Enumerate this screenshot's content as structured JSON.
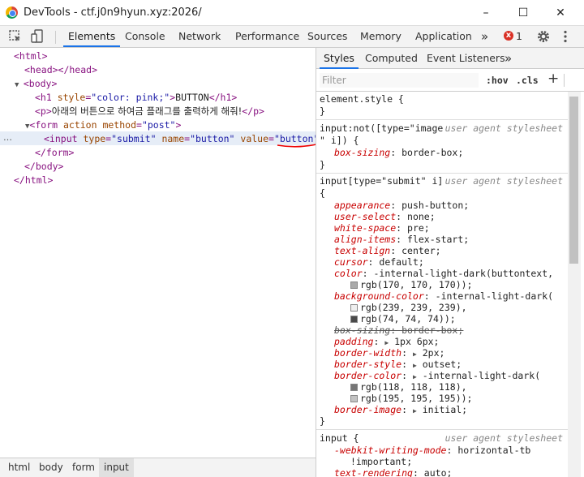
{
  "window": {
    "title": "DevTools - ctf.j0n9hyun.xyz:2026/",
    "min_label": "–",
    "max_label": "☐",
    "close_label": "✕"
  },
  "toolbar": {
    "tabs": [
      "Elements",
      "Console",
      "Network",
      "Performance",
      "Sources",
      "Memory",
      "Application"
    ],
    "more_label": "»",
    "error_count": "1",
    "error_icon": "x",
    "settings_icon": "gear-icon",
    "menu_icon": "kebab-icon"
  },
  "elements": {
    "html_open": "<html>",
    "head": "<head></head>",
    "body_open": "<body>",
    "h1_open": "<h1 ",
    "h1_attr": "style",
    "h1_val": "\"color: pink;\"",
    "h1_text": "BUTTON",
    "h1_close": "</h1>",
    "p_open": "<p>",
    "p_text": "아래의 버튼으로 하여금 플래그를 출력하게 해줘!",
    "p_close": "</p>",
    "form_open": "<form ",
    "form_attr1": "action",
    "form_attr2": "method",
    "form_val2": "\"post\"",
    "input_open": "<input ",
    "input_attr1": "type",
    "input_val1": "\"submit\"",
    "input_attr2": "name",
    "input_val2": "\"button\"",
    "input_attr3": "value",
    "input_val3_q1": "\"",
    "input_val3": "button",
    "input_val3_q2": "\"",
    "input_close": ">",
    "form_close": "</form>",
    "body_close": "</body>",
    "html_close": "</html>",
    "dots": "…"
  },
  "breadcrumbs": [
    "html",
    "body",
    "form",
    "input"
  ],
  "styles": {
    "tabs": [
      "Styles",
      "Computed",
      "Event Listeners"
    ],
    "more_label": "»",
    "filter_placeholder": "Filter",
    "hov": ":hov",
    "cls": ".cls",
    "plus": "+",
    "element_style": "element.style {",
    "close_brace": "}",
    "ua_label": "user agent stylesheet",
    "rule1_sel_a": "input:not([type=\"image",
    "rule1_sel_b": "\" i]) {",
    "rule1_prop": "box-sizing",
    "rule1_val": "border-box;",
    "rule2_sel": "input[type=\"submit\" i]",
    "rule2_open": "{",
    "props": [
      {
        "p": "appearance",
        "v": "push-button;"
      },
      {
        "p": "user-select",
        "v": "none;"
      },
      {
        "p": "white-space",
        "v": "pre;"
      },
      {
        "p": "align-items",
        "v": "flex-start;"
      },
      {
        "p": "text-align",
        "v": "center;"
      },
      {
        "p": "cursor",
        "v": "default;"
      },
      {
        "p": "color",
        "v": "-internal-light-dark(buttontext,"
      },
      {
        "p": "",
        "v": "rgb(170, 170, 170));"
      },
      {
        "p": "background-color",
        "v": "-internal-light-dark("
      },
      {
        "p": "",
        "v": "rgb(239, 239, 239),"
      },
      {
        "p": "",
        "v": "rgb(74, 74, 74));"
      },
      {
        "p": "box-sizing",
        "v": "border-box;"
      },
      {
        "p": "padding",
        "v": "1px 6px;"
      },
      {
        "p": "border-width",
        "v": "2px;"
      },
      {
        "p": "border-style",
        "v": "outset;"
      },
      {
        "p": "border-color",
        "v": "-internal-light-dark("
      },
      {
        "p": "",
        "v": "rgb(118, 118, 118),"
      },
      {
        "p": "",
        "v": "rgb(195, 195, 195));"
      },
      {
        "p": "border-image",
        "v": "initial;"
      }
    ],
    "rule3_sel": "input {",
    "rule3_prop1": "-webkit-writing-mode",
    "rule3_val1": "horizontal-tb",
    "rule3_val1b": "!important;",
    "rule3_prop2": "text-rendering",
    "rule3_val2": "auto;"
  },
  "colors": {
    "accent": "#1a73e8",
    "tag": "#881280",
    "attr": "#994500",
    "value": "#1a1aa6",
    "property": "#c80000",
    "swatch_170": "#aaaaaa",
    "swatch_239": "#efefef",
    "swatch_74": "#4a4a4a",
    "swatch_118": "#767676",
    "swatch_195": "#c3c3c3"
  }
}
